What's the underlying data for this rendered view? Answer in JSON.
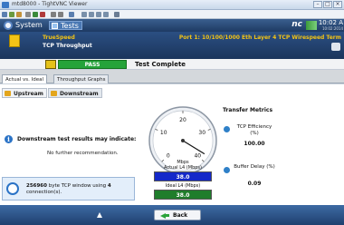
{
  "window": {
    "title": "mtd8000 - TightVNC Viewer"
  },
  "app_bar": {
    "system": "System",
    "tests": "Tests",
    "brand": "nc",
    "time": "10:02 A",
    "date": "10:02:2014"
  },
  "test_info": {
    "line1": "TrueSpeed",
    "line2": "TCP Throughput",
    "port": "Port 1: 10/100/1000 Eth Layer 4 TCP Wirespeed Term"
  },
  "status": {
    "result": "PASS",
    "message": "Test Complete"
  },
  "tabs": [
    {
      "label": "Actual vs. Ideal"
    },
    {
      "label": "Throughput Graphs"
    }
  ],
  "direction_tabs": [
    {
      "label": "Upstream"
    },
    {
      "label": "Downstream"
    }
  ],
  "main": {
    "results_title": "Downstream test results may indicate:",
    "results_detail": "No further recommendation.",
    "tcp_window_bold": "256960",
    "tcp_window_text": " byte TCP window using ",
    "tcp_connections_bold": "4",
    "tcp_connections_text": " connection(s)."
  },
  "gauge": {
    "unit": "Mbps",
    "ticks": [
      "0",
      "10",
      "20",
      "30",
      "40"
    ],
    "max": 40,
    "needle_value": 38,
    "actual_label": "Actual L4 (Mbps)",
    "actual_value": "38.0",
    "ideal_label": "Ideal L4 (Mbps)",
    "ideal_value": "38.0"
  },
  "metrics": {
    "title": "Transfer Metrics",
    "efficiency_label": "TCP Efficiency (%)",
    "efficiency_value": "100.00",
    "buffer_label": "Buffer Delay (%)",
    "buffer_value": "0.09"
  },
  "footer": {
    "back_label": "Back"
  },
  "colors": {
    "pass": "#25a33a",
    "actual": "#1428c9",
    "ideal": "#1f7d2b",
    "accent": "#f2c316"
  }
}
